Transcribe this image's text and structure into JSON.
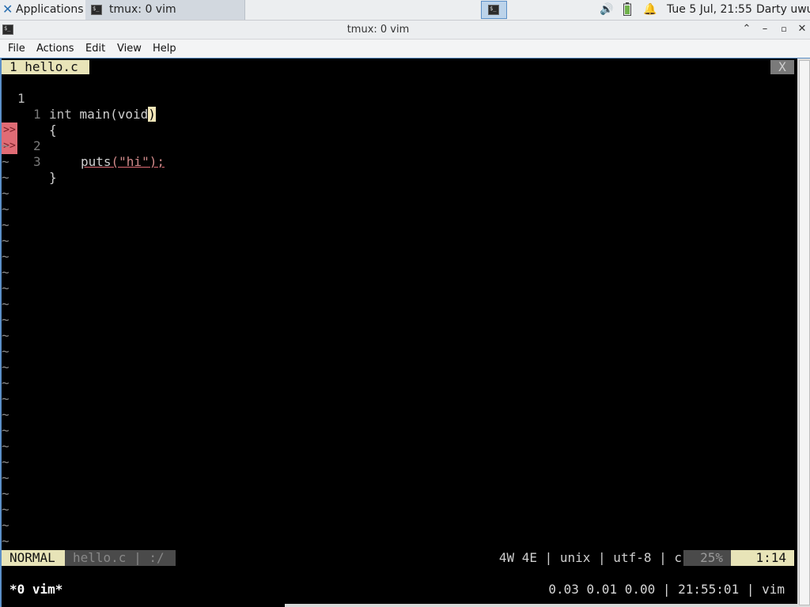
{
  "panel": {
    "applications_label": "Applications",
    "task_label": "tmux: 0 vim",
    "clock": "Tue  5 Jul, 21:55",
    "user": "Darty uwu",
    "icons": [
      "xfce-logo-icon",
      "terminal-icon",
      "volume-icon",
      "battery-icon",
      "notification-bell-icon"
    ]
  },
  "window": {
    "title": "tmux: 0 vim",
    "buttons": [
      "maximize-chevron",
      "minimize",
      "restore",
      "close"
    ]
  },
  "menu": {
    "file": "File",
    "actions": "Actions",
    "edit": "Edit",
    "view": "View",
    "help": "Help"
  },
  "vim": {
    "tab_label": "1 hello.c",
    "tab_close": "X",
    "lines": [
      {
        "num": "1",
        "sign": "",
        "code_kw": "int",
        "code_rest": " main(void"
      },
      {
        "num": "1",
        "sign": "",
        "code": "{"
      },
      {
        "num": "2",
        "sign": ">>",
        "code_func": "puts",
        "code_str": "(\"hi\");"
      },
      {
        "num": "3",
        "sign": ">>",
        "code": "}"
      }
    ],
    "tilde": "~",
    "cursor_char": ")",
    "status": {
      "mode": "NORMAL",
      "file": "hello.c | :/",
      "info": "4W 4E | unix | utf-8 | c",
      "percent": "25%",
      "position": "1:14"
    }
  },
  "tmux": {
    "left": "*0 vim*",
    "right": "0.03 0.01 0.00 | 21:55:01 | vim"
  },
  "colors": {
    "accent": "#5b8fc7",
    "vim_highlight": "#e8e4b8",
    "error_sign": "#e06c75"
  }
}
